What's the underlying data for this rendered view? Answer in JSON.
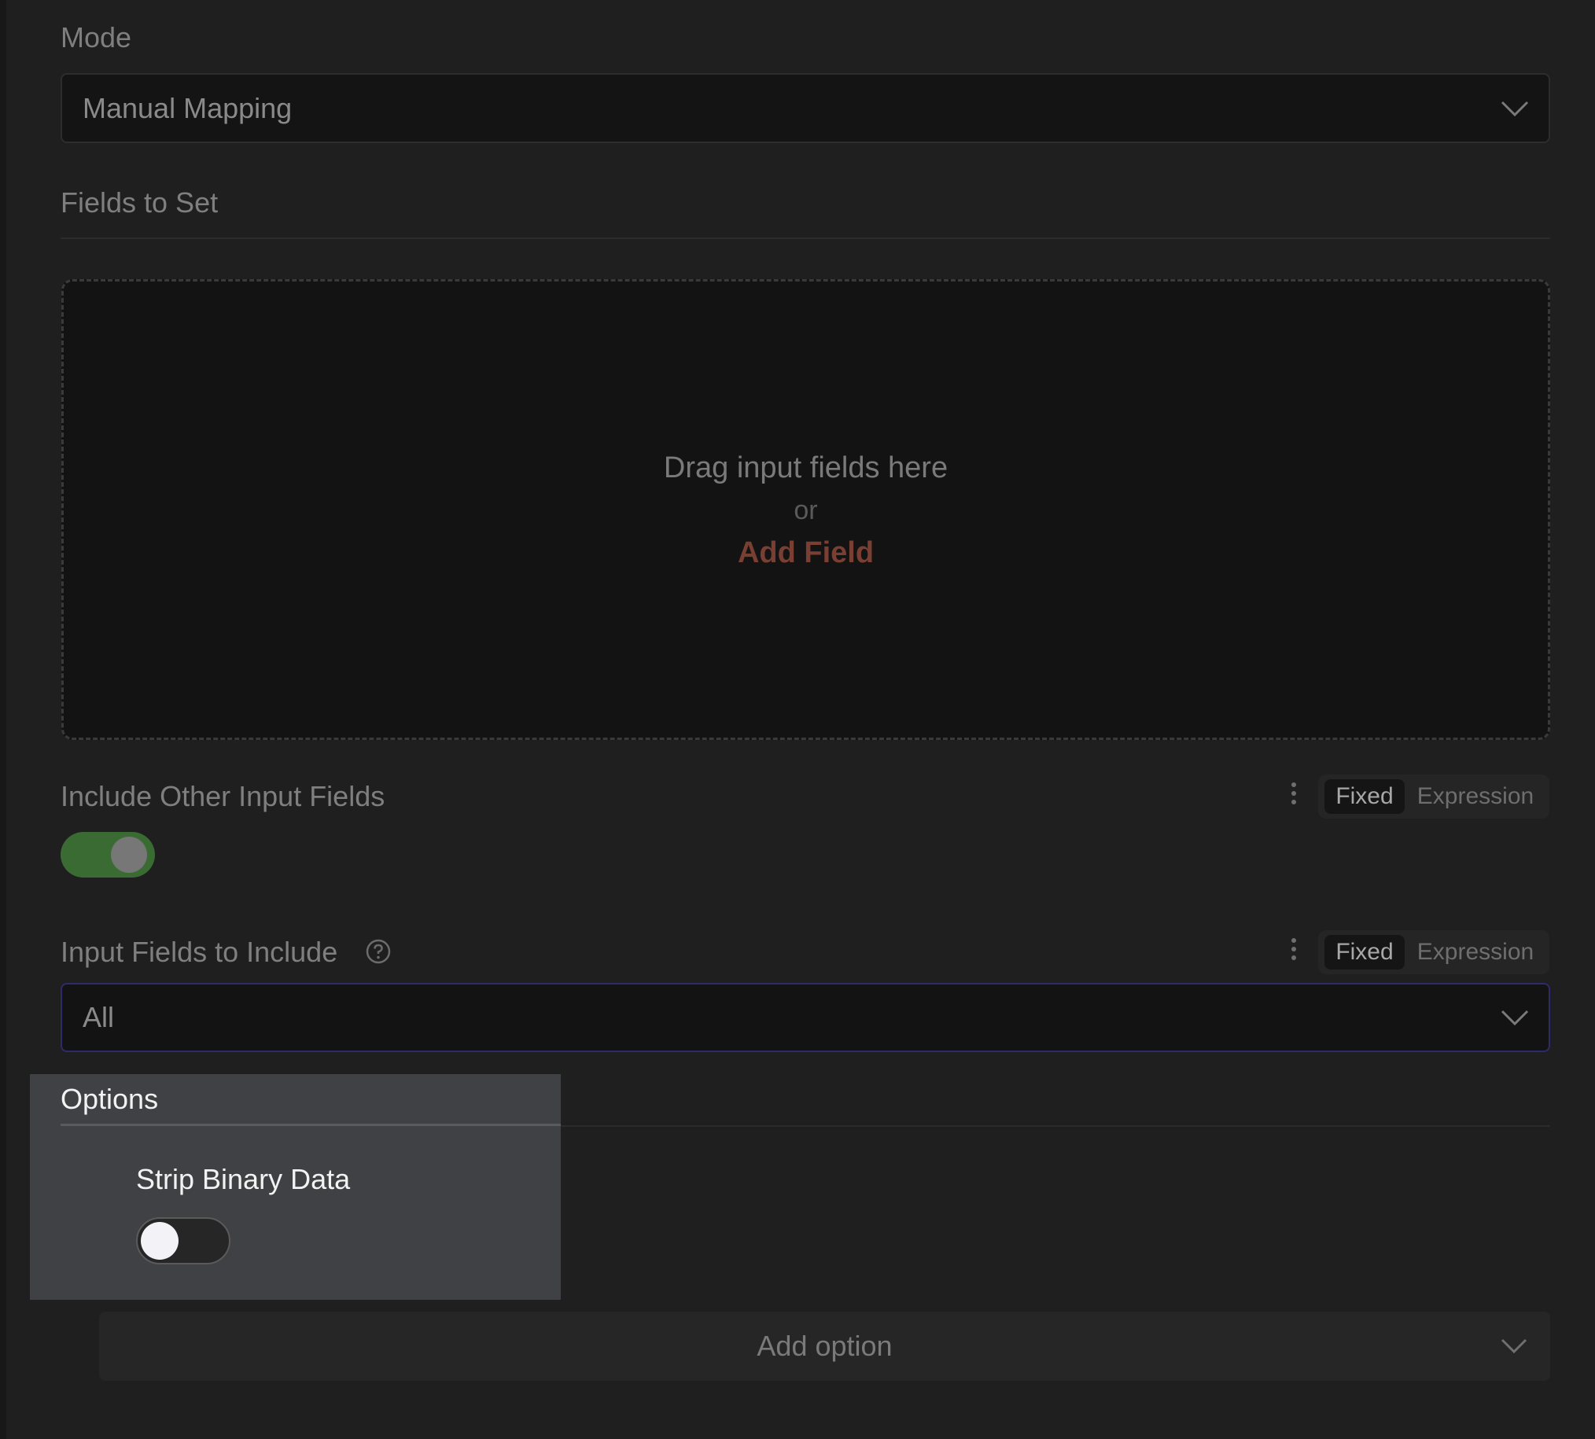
{
  "mode": {
    "label": "Mode",
    "value": "Manual Mapping"
  },
  "fields_to_set": {
    "title": "Fields to Set",
    "dropzone_text": "Drag input fields here",
    "dropzone_or": "or",
    "add_field_label": "Add Field"
  },
  "include_other": {
    "label": "Include Other Input Fields",
    "fixed_label": "Fixed",
    "expression_label": "Expression",
    "toggle_on": true
  },
  "input_fields": {
    "label": "Input Fields to Include",
    "fixed_label": "Fixed",
    "expression_label": "Expression",
    "value": "All"
  },
  "options": {
    "title": "Options",
    "strip_binary_label": "Strip Binary Data",
    "strip_binary_on": false,
    "add_option_label": "Add option"
  },
  "colors": {
    "accent_link": "#7a3f33",
    "toggle_on": "#3a6b33",
    "focus_border": "#2f2a6b"
  }
}
